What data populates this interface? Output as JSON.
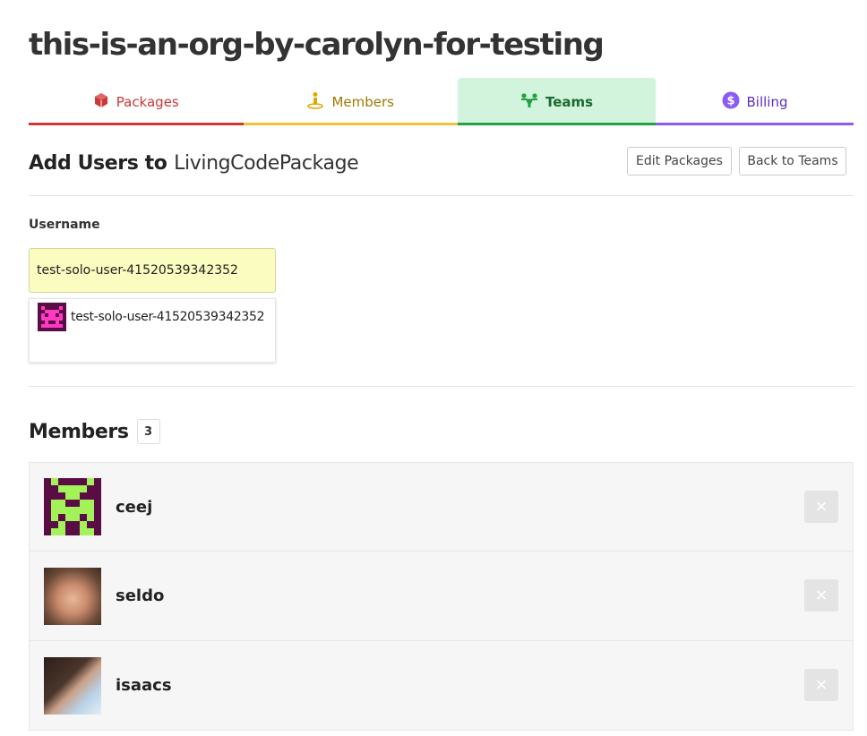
{
  "org": {
    "title": "this-is-an-org-by-carolyn-for-testing"
  },
  "tabs": [
    {
      "label": "Packages",
      "icon": "package-icon"
    },
    {
      "label": "Members",
      "icon": "member-icon"
    },
    {
      "label": "Teams",
      "icon": "teams-icon",
      "active": true
    },
    {
      "label": "Billing",
      "icon": "billing-icon"
    }
  ],
  "add_section": {
    "prefix": "Add Users to",
    "package": "LivingCodePackage",
    "edit_packages_label": "Edit Packages",
    "back_to_teams_label": "Back to Teams"
  },
  "form": {
    "username_label": "Username",
    "username_value": "test-solo-user-41520539342352",
    "suggestions": [
      {
        "name": "test-solo-user-41520539342352"
      }
    ]
  },
  "members": {
    "title": "Members",
    "count": "3",
    "remove_symbol": "×",
    "list": [
      {
        "name": "ceej"
      },
      {
        "name": "seldo"
      },
      {
        "name": "isaacs"
      }
    ]
  },
  "colors": {
    "packages": "#cb3837",
    "members": "#f0c33c",
    "teams": "#21a242",
    "billing": "#8a5cf5",
    "input_bg": "#fafcc0"
  }
}
